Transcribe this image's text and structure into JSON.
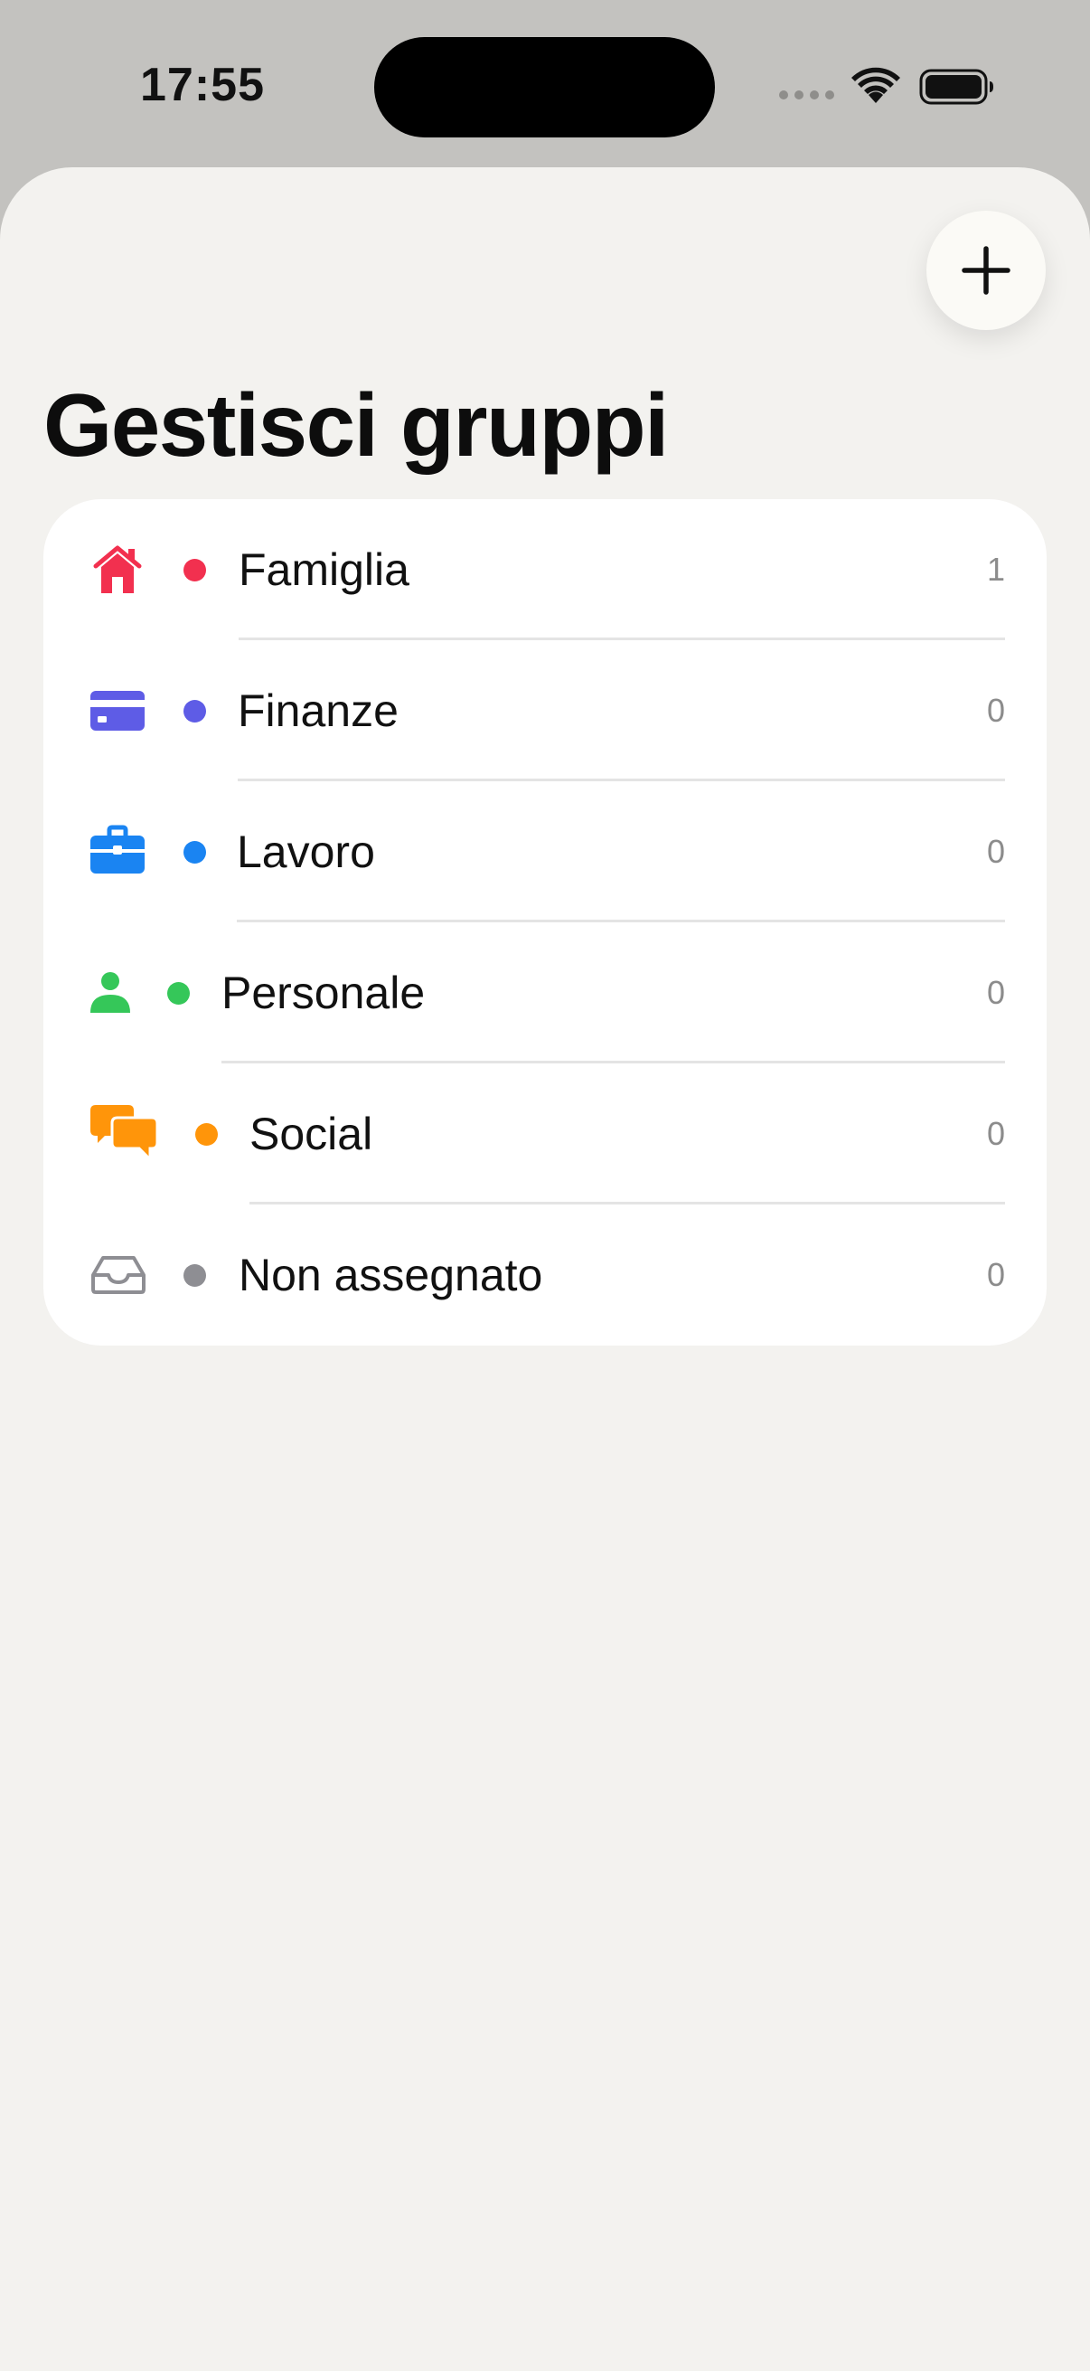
{
  "status_bar": {
    "time": "17:55",
    "icons": [
      "cellular-signal-icon",
      "wifi-icon",
      "battery-icon"
    ]
  },
  "header": {
    "add_button_icon": "plus-icon",
    "title": "Gestisci gruppi"
  },
  "groups": [
    {
      "icon": "house-icon",
      "label": "Famiglia",
      "count": "1",
      "color": "#f2304f"
    },
    {
      "icon": "credit-card-icon",
      "label": "Finanze",
      "count": "0",
      "color": "#5e5ce6"
    },
    {
      "icon": "briefcase-icon",
      "label": "Lavoro",
      "count": "0",
      "color": "#1a84f2"
    },
    {
      "icon": "person-icon",
      "label": "Personale",
      "count": "0",
      "color": "#35c759"
    },
    {
      "icon": "chat-bubbles-icon",
      "label": "Social",
      "count": "0",
      "color": "#ff950a"
    },
    {
      "icon": "inbox-tray-icon",
      "label": "Non assegnato",
      "count": "0",
      "color": "#8e8e93"
    }
  ]
}
